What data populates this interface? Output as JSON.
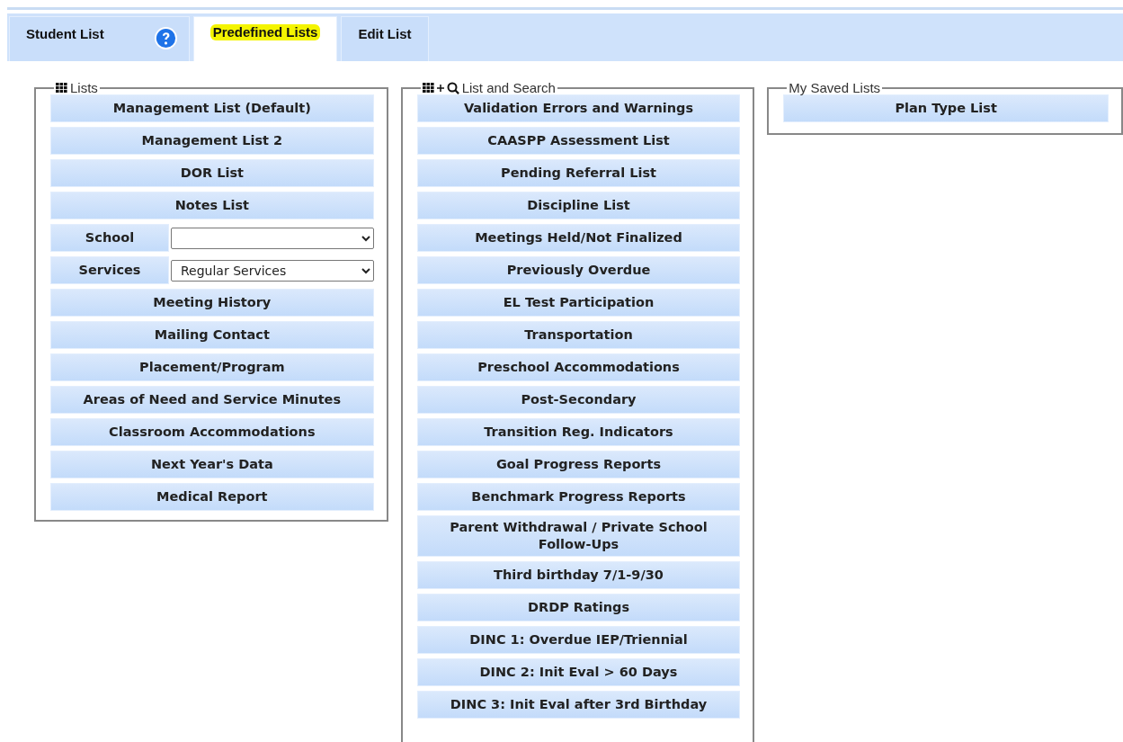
{
  "tabs": [
    {
      "label": "Student List",
      "selected": false,
      "highlighted": false,
      "help": true
    },
    {
      "label": "Predefined Lists",
      "selected": true,
      "highlighted": true,
      "help": false
    },
    {
      "label": "Edit List",
      "selected": false,
      "highlighted": false,
      "help": false
    }
  ],
  "panels": [
    {
      "legend": "Lists",
      "kind": "lists",
      "items": [
        {
          "kind": "button",
          "label": "Management List (Default)"
        },
        {
          "kind": "button",
          "label": "Management List 2"
        },
        {
          "kind": "button",
          "label": "DOR List"
        },
        {
          "kind": "button",
          "label": "Notes List"
        },
        {
          "kind": "select",
          "label": "School",
          "value": ""
        },
        {
          "kind": "select",
          "label": "Services",
          "value": "Regular Services"
        },
        {
          "kind": "button",
          "label": "Meeting History"
        },
        {
          "kind": "button",
          "label": "Mailing Contact"
        },
        {
          "kind": "button",
          "label": "Placement/Program"
        },
        {
          "kind": "button",
          "label": "Areas of Need and Service Minutes"
        },
        {
          "kind": "button",
          "label": "Classroom Accommodations"
        },
        {
          "kind": "button",
          "label": "Next Year's Data"
        },
        {
          "kind": "button",
          "label": "Medical Report"
        }
      ]
    },
    {
      "legend": "List and Search",
      "kind": "search",
      "items": [
        {
          "kind": "button",
          "label": "Validation Errors and Warnings"
        },
        {
          "kind": "button",
          "label": "CAASPP Assessment List"
        },
        {
          "kind": "button",
          "label": "Pending Referral List"
        },
        {
          "kind": "button",
          "label": "Discipline List"
        },
        {
          "kind": "button",
          "label": "Meetings Held/Not Finalized"
        },
        {
          "kind": "button",
          "label": "Previously Overdue"
        },
        {
          "kind": "button",
          "label": "EL Test Participation"
        },
        {
          "kind": "button",
          "label": "Transportation"
        },
        {
          "kind": "button",
          "label": "Preschool Accommodations"
        },
        {
          "kind": "button",
          "label": "Post-Secondary"
        },
        {
          "kind": "button",
          "label": "Transition Reg. Indicators"
        },
        {
          "kind": "button",
          "label": "Goal Progress Reports"
        },
        {
          "kind": "button",
          "label": "Benchmark Progress Reports"
        },
        {
          "kind": "button",
          "label": "Parent Withdrawal / Private School Follow-Ups"
        },
        {
          "kind": "button",
          "label": "Third birthday 7/1-9/30"
        },
        {
          "kind": "button",
          "label": "DRDP Ratings"
        },
        {
          "kind": "button",
          "label": "DINC 1: Overdue IEP/Triennial"
        },
        {
          "kind": "button",
          "label": "DINC 2: Init Eval > 60 Days"
        },
        {
          "kind": "button",
          "label": "DINC 3: Init Eval after 3rd Birthday"
        }
      ]
    },
    {
      "legend": "My Saved Lists",
      "kind": "saved",
      "items": [
        {
          "kind": "button",
          "label": "Plan Type List"
        }
      ]
    }
  ]
}
